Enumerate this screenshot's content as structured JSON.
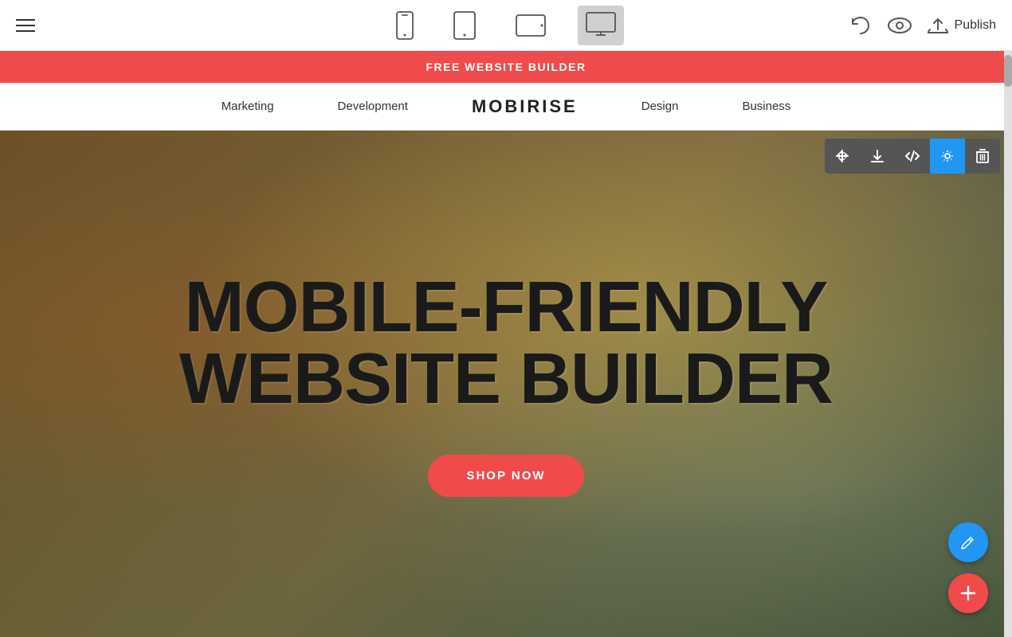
{
  "toolbar": {
    "publish_label": "Publish",
    "devices": [
      {
        "id": "mobile",
        "label": "Mobile view"
      },
      {
        "id": "tablet",
        "label": "Tablet view"
      },
      {
        "id": "tablet-landscape",
        "label": "Tablet landscape view"
      },
      {
        "id": "desktop",
        "label": "Desktop view"
      }
    ]
  },
  "banner": {
    "text": "FREE WEBSITE BUILDER"
  },
  "nav": {
    "logo": "MOBIRISE",
    "links": [
      "Marketing",
      "Development",
      "Design",
      "Business"
    ]
  },
  "hero": {
    "title_line1": "MOBILE-FRIENDLY",
    "title_line2": "WEBSITE BUILDER",
    "cta_label": "SHOP NOW"
  },
  "section_toolbar": {
    "buttons": [
      {
        "id": "move",
        "label": "Move"
      },
      {
        "id": "download",
        "label": "Download"
      },
      {
        "id": "code",
        "label": "Code"
      },
      {
        "id": "settings",
        "label": "Settings"
      },
      {
        "id": "delete",
        "label": "Delete"
      }
    ]
  },
  "fabs": {
    "pencil_label": "Edit",
    "add_label": "Add block"
  }
}
